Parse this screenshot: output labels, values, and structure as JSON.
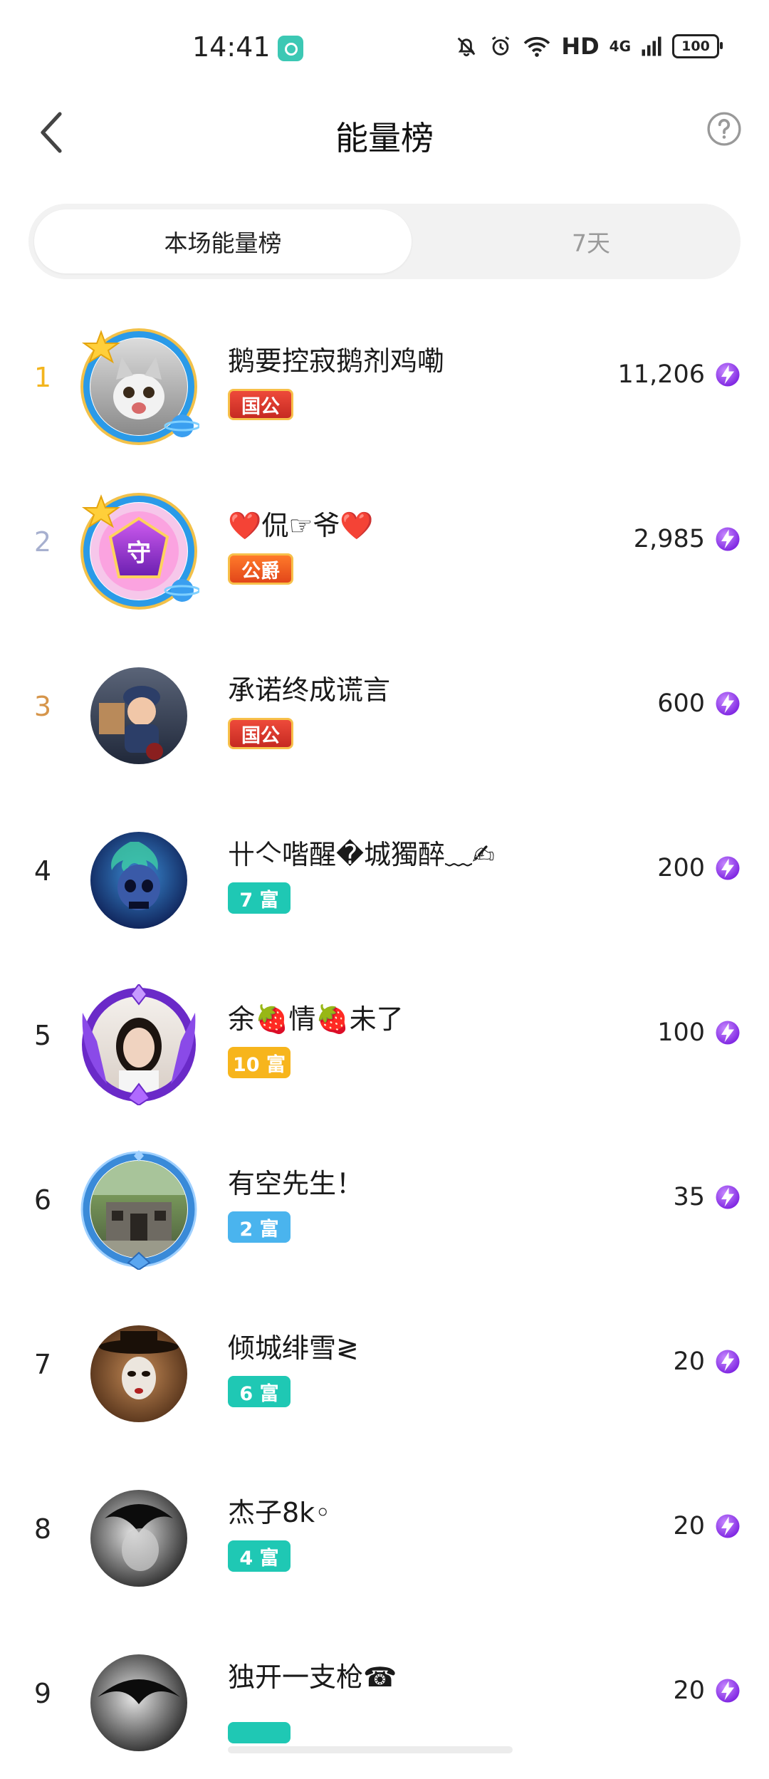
{
  "status_bar": {
    "time": "14:41",
    "icons": [
      "app-notification-icon",
      "mute-bell-icon",
      "alarm-icon",
      "wifi-icon",
      "signal-icon",
      "battery-icon"
    ],
    "hd": "HD",
    "network": "4G",
    "battery": "100"
  },
  "header": {
    "title": "能量榜",
    "back_icon": "chevron-left-icon",
    "help_icon": "question-circle-icon"
  },
  "tabs": [
    {
      "label": "本场能量榜",
      "active": true
    },
    {
      "label": "7天",
      "active": false
    }
  ],
  "colors": {
    "rank_gold": "#f3b51e",
    "rank_silver": "#a7b0cf",
    "rank_bronze": "#d6954a",
    "energy_purple": "#8a2be2",
    "badge_teal": "#1fc8b4",
    "badge_gold": "#f7b51c",
    "badge_blue": "#4ab4ee",
    "badge_red": "#d8322a"
  },
  "rankings": [
    {
      "rank": "1",
      "name": "鹅要控寂鹅剂鸡嘞",
      "badge": "国公",
      "badge_type": "noble",
      "score": "11,206",
      "avatar": "cat-avatar-with-gold-frame"
    },
    {
      "rank": "2",
      "name": "❤️侃☞爷❤️",
      "badge": "公爵",
      "badge_type": "duke",
      "score": "2,985",
      "avatar": "guardian-emblem-avatar-with-gold-frame"
    },
    {
      "rank": "3",
      "name": "承诺终成谎言",
      "badge": "国公",
      "badge_type": "noble",
      "score": "600",
      "avatar": "child-police-avatar"
    },
    {
      "rank": "4",
      "name": "卄亽喈醒�城獨醉﹏✍",
      "badge": "7 富",
      "badge_type": "rich-teal",
      "score": "200",
      "avatar": "skull-avatar"
    },
    {
      "rank": "5",
      "name": "余🍓情🍓未了",
      "badge": "10 富",
      "badge_type": "rich-gold",
      "score": "100",
      "avatar": "woman-portrait-avatar-with-purple-frame"
    },
    {
      "rank": "6",
      "name": "有空先生！",
      "badge": "2 富",
      "badge_type": "rich-blue",
      "score": "35",
      "avatar": "old-house-avatar-with-blue-frame"
    },
    {
      "rank": "7",
      "name": "倾城绯雪≷",
      "badge": "6 富",
      "badge_type": "rich-teal",
      "score": "20",
      "avatar": "masked-figure-avatar"
    },
    {
      "rank": "8",
      "name": "杰子8k◦",
      "badge": "4 富",
      "badge_type": "rich-teal",
      "score": "20",
      "avatar": "bw-face-avatar"
    },
    {
      "rank": "9",
      "name": "独开一支枪☎",
      "badge": "",
      "badge_type": "rich-teal",
      "score": "20",
      "avatar": "bw-face-avatar-2"
    }
  ]
}
